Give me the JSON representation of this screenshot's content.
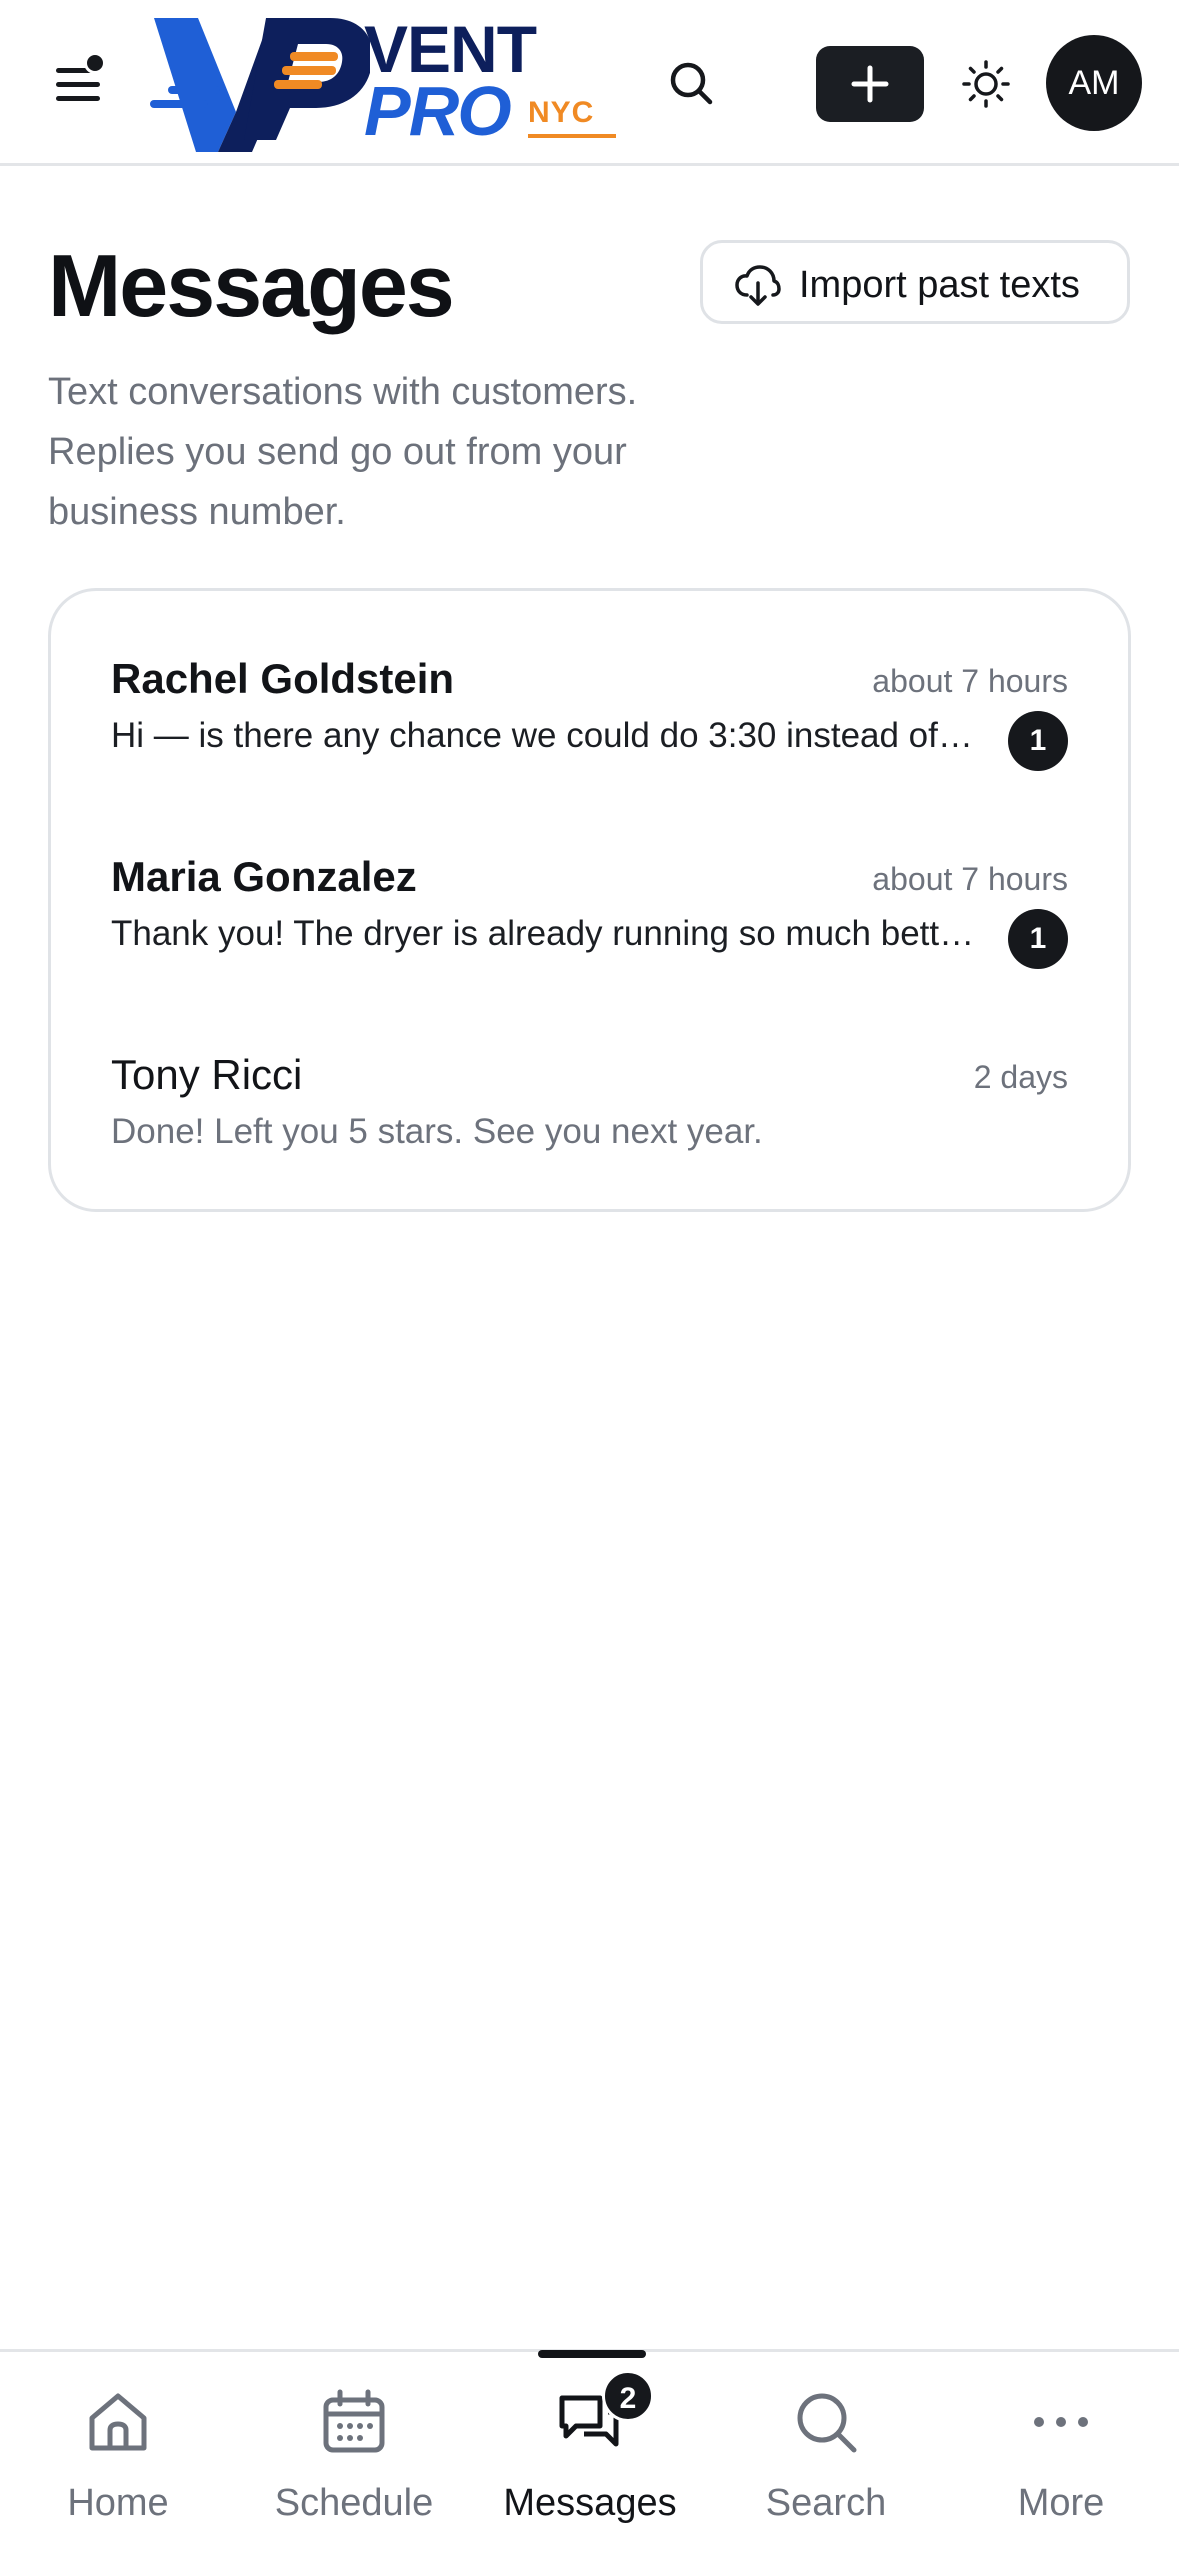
{
  "header": {
    "logo": {
      "line1": "VENT",
      "line2": "PRO",
      "tag": "NYC",
      "brand_colors": {
        "navy": "#0d1f5c",
        "blue": "#1f5fd6",
        "orange": "#f08a24"
      }
    },
    "menu_icon": "menu-icon",
    "menu_has_notification": true,
    "search_icon": "search-icon",
    "add_icon": "plus-icon",
    "theme_icon": "sun-icon",
    "avatar_initials": "AM"
  },
  "page": {
    "title": "Messages",
    "subtitle": "Text conversations with customers. Replies you send go out from your business number.",
    "import_button": {
      "label": "Import past texts",
      "icon": "cloud-download-icon"
    }
  },
  "conversations": [
    {
      "name": "Rachel Goldstein",
      "time": "about 7 hours",
      "preview": "Hi — is there any chance we could do 3:30 instead of…",
      "unread": "1"
    },
    {
      "name": "Maria Gonzalez",
      "time": "about 7 hours",
      "preview": "Thank you! The dryer is already running so much bett…",
      "unread": "1"
    },
    {
      "name": "Tony Ricci",
      "time": "2 days",
      "preview": "Done! Left you 5 stars. See you next year.",
      "unread": ""
    }
  ],
  "bottom_nav": {
    "items": [
      {
        "label": "Home",
        "icon": "home-icon"
      },
      {
        "label": "Schedule",
        "icon": "calendar-icon"
      },
      {
        "label": "Messages",
        "icon": "chat-icon",
        "badge": "2",
        "active": true
      },
      {
        "label": "Search",
        "icon": "search-icon"
      },
      {
        "label": "More",
        "icon": "more-icon"
      }
    ]
  }
}
